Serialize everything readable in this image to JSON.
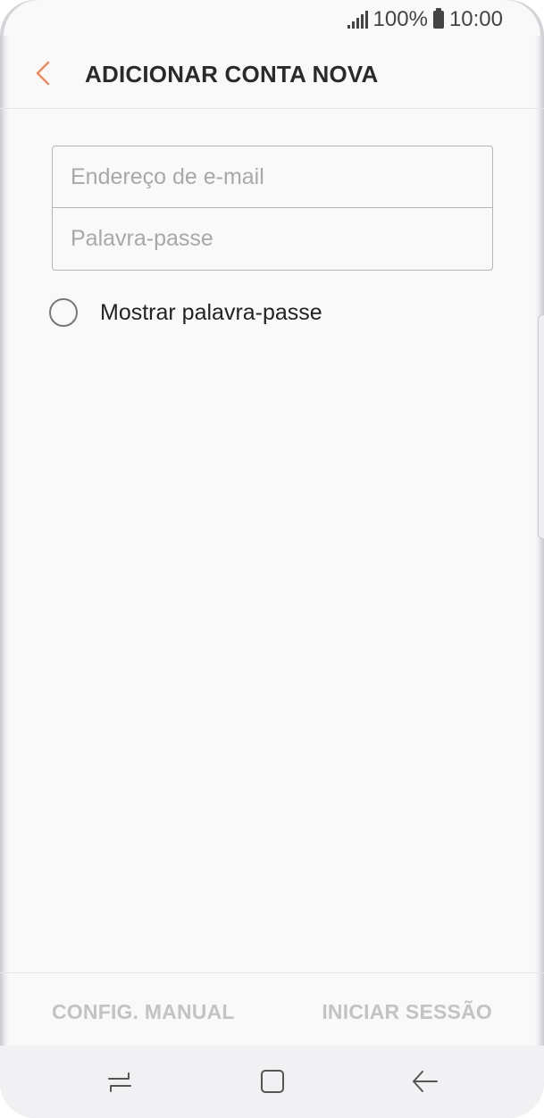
{
  "status_bar": {
    "battery": "100%",
    "time": "10:00"
  },
  "app_bar": {
    "title": "ADICIONAR CONTA NOVA"
  },
  "form": {
    "email_placeholder": "Endereço de e-mail",
    "email_value": "",
    "password_placeholder": "Palavra-passe",
    "password_value": "",
    "show_password_label": "Mostrar palavra-passe"
  },
  "actions": {
    "manual_label": "CONFIG. MANUAL",
    "login_label": "INICIAR SESSÃO"
  },
  "colors": {
    "accent": "#f08a5d",
    "disabled_text": "#c3c3c3"
  },
  "icons": {
    "back": "chevron-left-icon",
    "signal": "signal-icon",
    "battery": "battery-icon",
    "nav_recent": "recent-apps-icon",
    "nav_home": "home-icon",
    "nav_back": "back-arrow-icon"
  }
}
